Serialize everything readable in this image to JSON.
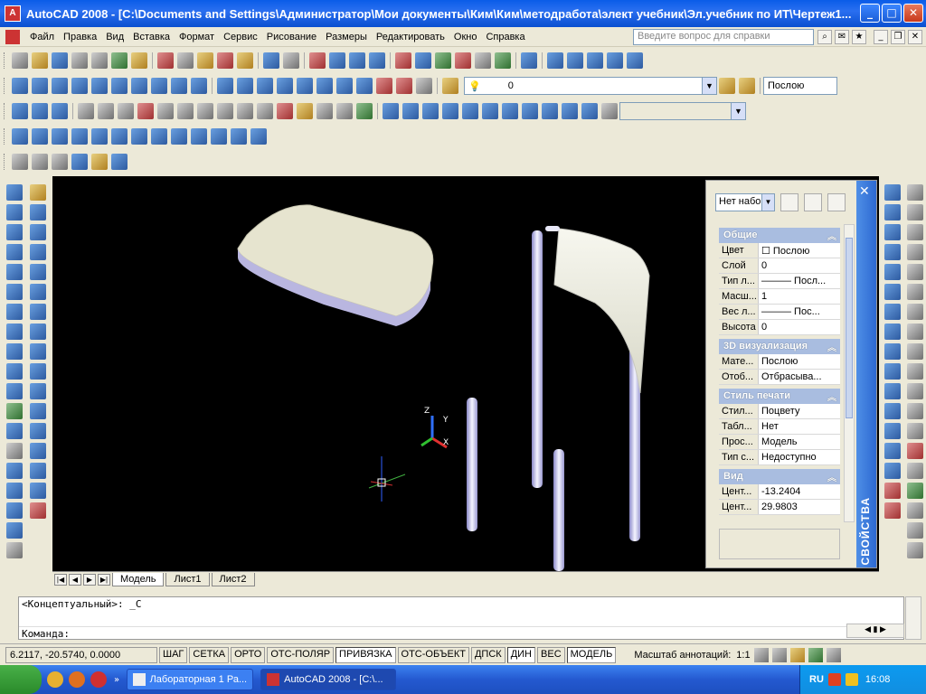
{
  "window": {
    "title": "AutoCAD 2008 - [C:\\Documents and Settings\\Администратор\\Мои документы\\Ким\\Ким\\методработа\\элект учебник\\Эл.учебник по ИТ\\Чертеж1...",
    "minimize": "_",
    "maximize": "□",
    "close": "✕"
  },
  "menubar": {
    "items": [
      "Файл",
      "Правка",
      "Вид",
      "Вставка",
      "Формат",
      "Сервис",
      "Рисование",
      "Размеры",
      "Редактировать",
      "Окно",
      "Справка"
    ],
    "help_placeholder": "Введите вопрос для справки"
  },
  "layers": {
    "current_layer": "0",
    "color_value": "Послою"
  },
  "drawing_tabs": [
    "Модель",
    "Лист1",
    "Лист2"
  ],
  "properties": {
    "strip_label": "СВОЙСТВА",
    "close": "✕",
    "selection": "Нет набо",
    "sections": [
      {
        "title": "Общие",
        "rows": [
          {
            "k": "Цвет",
            "v": "☐ Послою"
          },
          {
            "k": "Слой",
            "v": "0"
          },
          {
            "k": "Тип л...",
            "v": "——— Посл..."
          },
          {
            "k": "Масш...",
            "v": "1"
          },
          {
            "k": "Вес л...",
            "v": "——— Пос..."
          },
          {
            "k": "Высота",
            "v": "0"
          }
        ]
      },
      {
        "title": "3D визуализация",
        "rows": [
          {
            "k": "Мате...",
            "v": "Послою"
          },
          {
            "k": "Отоб...",
            "v": "Отбрасыва..."
          }
        ]
      },
      {
        "title": "Стиль печати",
        "rows": [
          {
            "k": "Стил...",
            "v": "Поцвету"
          },
          {
            "k": "Табл...",
            "v": "Нет"
          },
          {
            "k": "Прос...",
            "v": "Модель"
          },
          {
            "k": "Тип с...",
            "v": "Недоступно"
          }
        ]
      },
      {
        "title": "Вид",
        "rows": [
          {
            "k": "Цент...",
            "v": "-13.2404"
          },
          {
            "k": "Цент...",
            "v": "29.9803"
          }
        ]
      }
    ]
  },
  "command": {
    "history": "<Концептуальный>: _C",
    "prompt": "Команда:"
  },
  "status": {
    "coords": "6.2117,  -20.5740, 0.0000",
    "buttons": [
      {
        "label": "ШАГ",
        "on": false
      },
      {
        "label": "СЕТКА",
        "on": false
      },
      {
        "label": "ОРТО",
        "on": false
      },
      {
        "label": "ОТС-ПОЛЯР",
        "on": false
      },
      {
        "label": "ПРИВЯЗКА",
        "on": true
      },
      {
        "label": "ОТС-ОБЪЕКТ",
        "on": false
      },
      {
        "label": "ДПСК",
        "on": false
      },
      {
        "label": "ДИН",
        "on": true
      },
      {
        "label": "ВЕС",
        "on": false
      },
      {
        "label": "МОДЕЛЬ",
        "on": true
      }
    ],
    "annotation_scale_label": "Масштаб аннотаций:",
    "annotation_scale_value": "1:1"
  },
  "taskbar": {
    "tasks": [
      {
        "label": "Лабораторная 1  Ра...",
        "active": false
      },
      {
        "label": "AutoCAD 2008 - [C:\\...",
        "active": true
      }
    ],
    "lang": "RU",
    "time": "16:08"
  },
  "axes": {
    "z": "Z",
    "y": "Y",
    "x": "X"
  }
}
